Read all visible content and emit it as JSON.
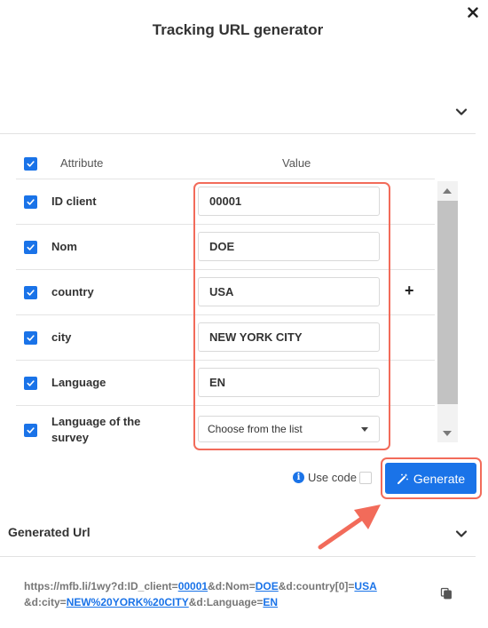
{
  "dialog": {
    "title": "Tracking URL generator"
  },
  "table": {
    "header_attribute": "Attribute",
    "header_value": "Value",
    "rows": [
      {
        "label": "ID client",
        "value": "00001",
        "checked": true
      },
      {
        "label": "Nom",
        "value": "DOE",
        "checked": true
      },
      {
        "label": "country",
        "value": "USA",
        "checked": true
      },
      {
        "label": "city",
        "value": "NEW YORK CITY",
        "checked": true
      },
      {
        "label": "Language",
        "value": "EN",
        "checked": true
      },
      {
        "label_line1": "Language of the",
        "label_line2": "survey",
        "select_value": "Choose from the list",
        "checked": true
      }
    ],
    "add_symbol": "+"
  },
  "actions": {
    "info_icon": "i",
    "use_code_label": "Use code",
    "use_code_checked": false,
    "generate_label": "Generate"
  },
  "generated": {
    "section_title": "Generated Url",
    "url_parts": {
      "p1": "https://mfb.li/1wy?d:ID_client=",
      "v1": "00001",
      "p2": "&d:Nom=",
      "v2": "DOE",
      "p3": "&d:country[0]=",
      "v3": "USA",
      "p4": "&d:city=",
      "v4": "NEW%20YORK%20CITY",
      "p5": "&d:Language=",
      "v5": "EN"
    }
  },
  "colors": {
    "accent": "#1a73e8",
    "highlight": "#f26b5a"
  },
  "icons": {
    "close": "close-icon",
    "chevron": "chevron-down-icon",
    "check": "check-icon",
    "magic": "magic-wand-icon",
    "copy": "copy-icon",
    "arrow": "annotation-arrow"
  }
}
